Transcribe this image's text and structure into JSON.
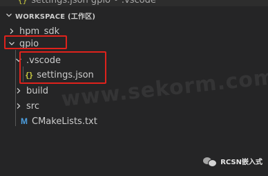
{
  "top_strip": {
    "text": "settings.json gpio • .vscode"
  },
  "explorer": {
    "section_title": "WORKSPACE (工作区)",
    "items": [
      {
        "label": "hpm_sdk",
        "type": "folder",
        "expanded": false
      },
      {
        "label": "gpio",
        "type": "folder",
        "expanded": true
      },
      {
        "label": ".vscode",
        "type": "folder",
        "expanded": true
      },
      {
        "label": "settings.json",
        "type": "file",
        "icon": "json-icon"
      },
      {
        "label": "build",
        "type": "folder",
        "expanded": false
      },
      {
        "label": "src",
        "type": "folder",
        "expanded": false
      },
      {
        "label": "CMakeLists.txt",
        "type": "file",
        "icon": "cmake-icon"
      }
    ]
  },
  "icons": {
    "json_glyph": "{}",
    "cmake_glyph": "M"
  },
  "watermark": {
    "text": "www.sekorm.com"
  },
  "brand": {
    "text": "RCSN嵌入式"
  },
  "colors": {
    "background": "#252526",
    "text": "#cccccc",
    "highlight_box": "#e0221c",
    "json_icon": "#cbcb41",
    "cmake_icon": "#4d9fe0"
  }
}
